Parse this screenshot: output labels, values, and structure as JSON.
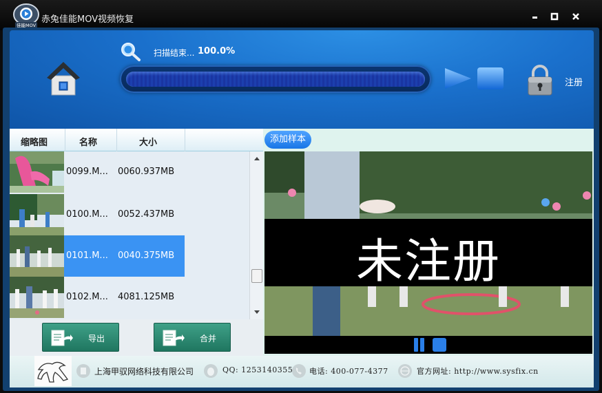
{
  "window": {
    "title": "赤兔佳能MOV视频恢复",
    "logo_text": "佳能MOV",
    "controls": {
      "minimize": "▪",
      "maximize": "▪",
      "close": "✕"
    }
  },
  "toolbar": {
    "scan_status": "扫描结束...",
    "scan_percent": "100.0%",
    "progress": 1.0,
    "register_label": "注册",
    "icons": [
      "home-icon",
      "search-icon",
      "play-icon",
      "stop-icon",
      "lock-icon"
    ]
  },
  "file_list": {
    "columns": [
      "缩略图",
      "名称",
      "大小"
    ],
    "rows": [
      {
        "name": "0099.M...",
        "size": "0060.937MB",
        "selected": false
      },
      {
        "name": "0100.M...",
        "size": "0052.437MB",
        "selected": false
      },
      {
        "name": "0101.M...",
        "size": "0040.375MB",
        "selected": true
      },
      {
        "name": "0102.M...",
        "size": "4081.125MB",
        "selected": false
      }
    ],
    "export_label": "导出",
    "merge_label": "合并"
  },
  "preview": {
    "add_sample_label": "添加样本",
    "watermark_text": "未注册",
    "controls": [
      "pause-icon",
      "stop-icon"
    ]
  },
  "footer": {
    "company": "上海甲驭网络科技有限公司",
    "qq": "QQ: 1253140355",
    "phone": "电话: 400-077-4377",
    "website": "官方网址: http://www.sysfix.cn"
  },
  "colors": {
    "accent_blue": "#1a70cc",
    "selection": "#3a93f3",
    "action_green": "#2a8a72"
  }
}
